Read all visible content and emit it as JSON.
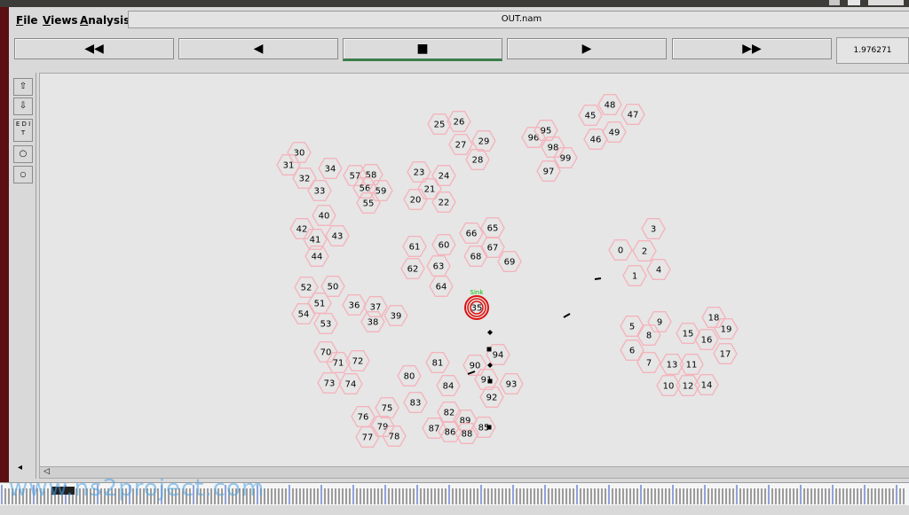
{
  "menu": {
    "file": "File",
    "views": "Views",
    "analysis": "Analysis"
  },
  "window": {
    "filename": "OUT.nam"
  },
  "controls": {
    "rewind": "◀◀",
    "back": "◀",
    "stop": "■",
    "play": "▶",
    "fastforward": "▶▶",
    "time": "1.976271"
  },
  "tools": {
    "edit": "E D I T"
  },
  "sink_label": "Sink",
  "watermark": "www.ns2project.com",
  "nodes": [
    {
      "id": "30"
    },
    {
      "id": "31"
    },
    {
      "id": "32"
    },
    {
      "id": "33"
    },
    {
      "id": "34"
    },
    {
      "id": "57"
    },
    {
      "id": "58"
    },
    {
      "id": "56"
    },
    {
      "id": "59"
    },
    {
      "id": "55"
    },
    {
      "id": "40"
    },
    {
      "id": "42"
    },
    {
      "id": "41"
    },
    {
      "id": "43"
    },
    {
      "id": "44"
    },
    {
      "id": "52"
    },
    {
      "id": "50"
    },
    {
      "id": "51"
    },
    {
      "id": "54"
    },
    {
      "id": "53"
    },
    {
      "id": "36"
    },
    {
      "id": "37"
    },
    {
      "id": "38"
    },
    {
      "id": "39"
    },
    {
      "id": "70"
    },
    {
      "id": "71"
    },
    {
      "id": "72"
    },
    {
      "id": "73"
    },
    {
      "id": "74"
    },
    {
      "id": "25"
    },
    {
      "id": "26"
    },
    {
      "id": "27"
    },
    {
      "id": "29"
    },
    {
      "id": "28"
    },
    {
      "id": "23"
    },
    {
      "id": "24"
    },
    {
      "id": "21"
    },
    {
      "id": "20"
    },
    {
      "id": "22"
    },
    {
      "id": "61"
    },
    {
      "id": "60"
    },
    {
      "id": "62"
    },
    {
      "id": "63"
    },
    {
      "id": "64"
    },
    {
      "id": "66"
    },
    {
      "id": "65"
    },
    {
      "id": "67"
    },
    {
      "id": "68"
    },
    {
      "id": "69"
    },
    {
      "id": "96"
    },
    {
      "id": "95"
    },
    {
      "id": "98"
    },
    {
      "id": "99"
    },
    {
      "id": "97"
    },
    {
      "id": "45"
    },
    {
      "id": "48"
    },
    {
      "id": "47"
    },
    {
      "id": "46"
    },
    {
      "id": "49"
    },
    {
      "id": "3"
    },
    {
      "id": "0"
    },
    {
      "id": "2"
    },
    {
      "id": "4"
    },
    {
      "id": "1"
    },
    {
      "id": "5"
    },
    {
      "id": "9"
    },
    {
      "id": "8"
    },
    {
      "id": "6"
    },
    {
      "id": "7"
    },
    {
      "id": "18"
    },
    {
      "id": "15"
    },
    {
      "id": "19"
    },
    {
      "id": "16"
    },
    {
      "id": "17"
    },
    {
      "id": "13"
    },
    {
      "id": "11"
    },
    {
      "id": "10"
    },
    {
      "id": "12"
    },
    {
      "id": "14"
    },
    {
      "id": "81"
    },
    {
      "id": "90"
    },
    {
      "id": "94"
    },
    {
      "id": "80"
    },
    {
      "id": "84"
    },
    {
      "id": "91"
    },
    {
      "id": "93"
    },
    {
      "id": "92"
    },
    {
      "id": "83"
    },
    {
      "id": "82"
    },
    {
      "id": "89"
    },
    {
      "id": "87"
    },
    {
      "id": "86"
    },
    {
      "id": "88"
    },
    {
      "id": "85"
    },
    {
      "id": "75"
    },
    {
      "id": "76"
    },
    {
      "id": "79"
    },
    {
      "id": "77"
    },
    {
      "id": "78"
    },
    {
      "id": "35",
      "sink": true
    }
  ],
  "colors": {
    "node_outline": "#f4b4bc",
    "sink": "#e01010",
    "active_button": "#3a7d4a"
  }
}
